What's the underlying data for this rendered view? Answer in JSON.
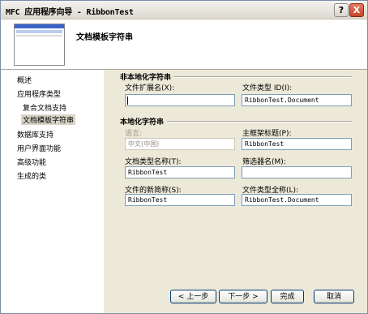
{
  "window": {
    "title": "MFC 应用程序向导 - RibbonTest",
    "help_button": "?",
    "close_button": "X"
  },
  "header": {
    "title": "文档模板字符串"
  },
  "nav": {
    "items": [
      {
        "label": "概述"
      },
      {
        "label": "应用程序类型"
      },
      {
        "label": "复合文档支持"
      },
      {
        "label": "文档模板字符串"
      },
      {
        "label": "数据库支持"
      },
      {
        "label": "用户界面功能"
      },
      {
        "label": "高级功能"
      },
      {
        "label": "生成的类"
      }
    ]
  },
  "nonlocalized": {
    "title": "非本地化字符串",
    "file_ext_label": "文件扩展名(X):",
    "file_ext_value": "",
    "file_type_id_label": "文件类型 ID(I):",
    "file_type_id_value": "RibbonTest.Document"
  },
  "localized": {
    "title": "本地化字符串",
    "language_label": "语言:",
    "language_value": "中文(中国)",
    "main_frame_label": "主框架标题(P):",
    "main_frame_value": "RibbonTest",
    "doc_type_name_label": "文档类型名称(T):",
    "doc_type_name_value": "RibbonTest",
    "filter_name_label": "筛选器名(M):",
    "filter_name_value": "",
    "new_short_name_label": "文件的新简称(S):",
    "new_short_name_value": "RibbonTest",
    "file_type_full_label": "文件类型全称(L):",
    "file_type_full_value": "RibbonTest.Document"
  },
  "buttons": {
    "prev": "< 上一步",
    "next": "下一步 >",
    "finish": "完成",
    "cancel": "取消"
  }
}
